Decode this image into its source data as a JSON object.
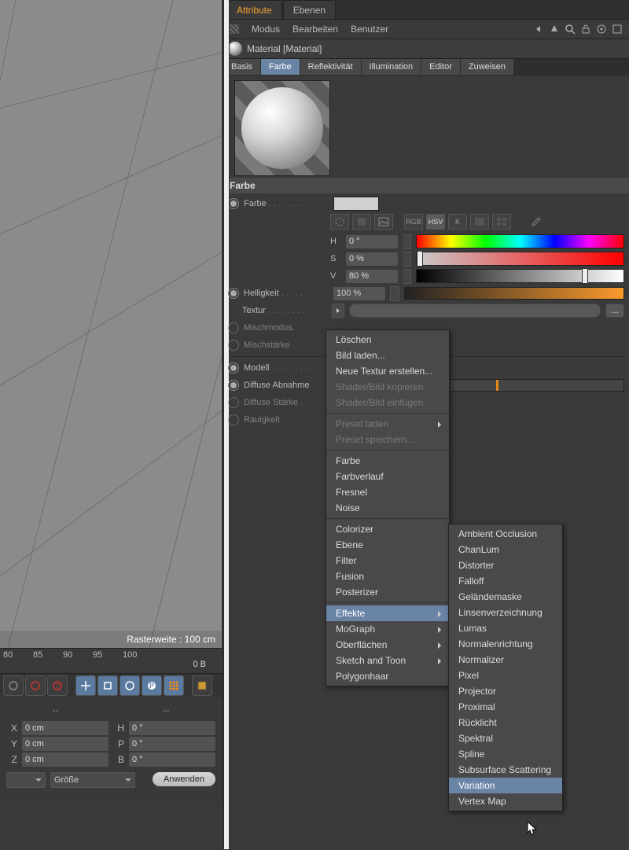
{
  "viewport": {
    "raster": "Rasterweite : 100 cm"
  },
  "timeline": {
    "marks": [
      "80",
      "85",
      "90",
      "95",
      "100"
    ],
    "frame": "0 B"
  },
  "coords": {
    "rows": [
      {
        "a": "X",
        "av": "0 cm",
        "b": "H",
        "bv": "0 °"
      },
      {
        "a": "Y",
        "av": "0 cm",
        "b": "P",
        "bv": "0 °"
      },
      {
        "a": "Z",
        "av": "0 cm",
        "b": "B",
        "bv": "0 °"
      }
    ],
    "size_label": "Größe",
    "apply": "Anwenden"
  },
  "panel": {
    "tabs": [
      "Attribute",
      "Ebenen"
    ],
    "menus": [
      "Modus",
      "Bearbeiten",
      "Benutzer"
    ],
    "object": "Material [Material]",
    "channels": [
      "Basis",
      "Farbe",
      "Reflektivität",
      "Illumination",
      "Editor",
      "Zuweisen"
    ],
    "active_channel": 1,
    "section": "Farbe",
    "color_label": "Farbe",
    "hsv": {
      "H": "0 °",
      "S": "0 %",
      "V": "80 %"
    },
    "brightness_label": "Helligkeit",
    "brightness_value": "100 %",
    "texture_label": "Textur",
    "mix_mode": "Mischmodus.",
    "mix_strength": "Mischstärke",
    "model": "Modell",
    "diffuse_falloff": "Diffuse Abnahme",
    "diffuse_strength": "Diffuse Stärke",
    "roughness": "Rauigkeit",
    "icon_row": [
      "",
      "",
      "",
      "RGB",
      "HSV",
      "K",
      "",
      "",
      ""
    ],
    "texture_more": "..."
  },
  "menu1": {
    "items": [
      {
        "t": "Löschen"
      },
      {
        "t": "Bild laden..."
      },
      {
        "t": "Neue Textur erstellen..."
      },
      {
        "t": "Shader/Bild kopieren",
        "disabled": true
      },
      {
        "t": "Shader/Bild einfügen",
        "disabled": true
      },
      {
        "sep": true
      },
      {
        "t": "Preset laden",
        "sub": true,
        "disabled": true
      },
      {
        "t": "Preset speichern...",
        "disabled": true
      },
      {
        "sep": true
      },
      {
        "t": "Farbe"
      },
      {
        "t": "Farbverlauf"
      },
      {
        "t": "Fresnel"
      },
      {
        "t": "Noise"
      },
      {
        "sep": true
      },
      {
        "t": "Colorizer"
      },
      {
        "t": "Ebene"
      },
      {
        "t": "Filter"
      },
      {
        "t": "Fusion"
      },
      {
        "t": "Posterizer"
      },
      {
        "sep": true
      },
      {
        "t": "Effekte",
        "sub": true,
        "hl": true
      },
      {
        "t": "MoGraph",
        "sub": true
      },
      {
        "t": "Oberflächen",
        "sub": true
      },
      {
        "t": "Sketch and Toon",
        "sub": true
      },
      {
        "t": "Polygonhaar"
      }
    ]
  },
  "menu2": {
    "items": [
      "Ambient Occlusion",
      "ChanLum",
      "Distorter",
      "Falloff",
      "Geländemaske",
      "Linsenverzeichnung",
      "Lumas",
      "Normalenrichtung",
      "Normalizer",
      "Pixel",
      "Projector",
      "Proximal",
      "Rücklicht",
      "Spektral",
      "Spline",
      "Subsurface Scattering",
      "Variation",
      "Vertex Map"
    ],
    "highlight": "Variation"
  }
}
